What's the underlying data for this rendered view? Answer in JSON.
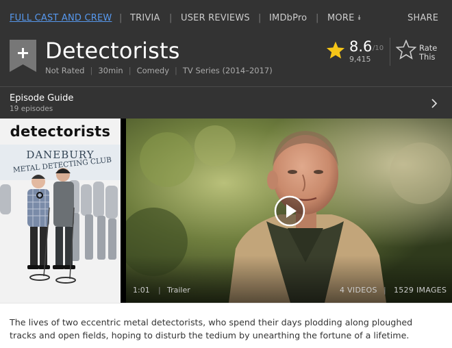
{
  "nav": {
    "items": [
      {
        "label": "FULL CAST AND CREW",
        "link": true
      },
      {
        "label": "TRIVIA",
        "link": false
      },
      {
        "label": "USER REVIEWS",
        "link": false
      },
      {
        "label": "IMDbPro",
        "link": false
      },
      {
        "label": "MORE",
        "link": false
      }
    ],
    "share_label": "SHARE",
    "more_icon": "double-chevron-down-icon"
  },
  "title": {
    "name": "Detectorists",
    "watchlist_icon": "plus-icon",
    "meta": [
      "Not Rated",
      "30min",
      "Comedy",
      "TV Series (2014–2017)"
    ]
  },
  "rating": {
    "value": "8.6",
    "out_of": "/10",
    "count": "9,415",
    "rate_label_line1": "Rate",
    "rate_label_line2": "This",
    "star_color": "#f5c518"
  },
  "episode_guide": {
    "label": "Episode Guide",
    "count": "19 episodes",
    "arrow_icon": "chevron-right-icon"
  },
  "poster": {
    "title": "detectorists",
    "sign_line1": "DANEBURY",
    "sign_line2": "METAL DETECTING CLUB"
  },
  "video": {
    "play_icon": "play-icon",
    "duration": "1:01",
    "type": "Trailer",
    "videos_count": "4 VIDEOS",
    "images_count": "1529 IMAGES"
  },
  "summary": {
    "text": "The lives of two eccentric metal detectorists, who spend their days plodding along ploughed tracks and open fields, hoping to disturb the tedium by unearthing the fortune of a lifetime."
  },
  "colors": {
    "header_bg": "#333333",
    "link": "#5799ef",
    "text_muted": "#aaaaaa"
  }
}
